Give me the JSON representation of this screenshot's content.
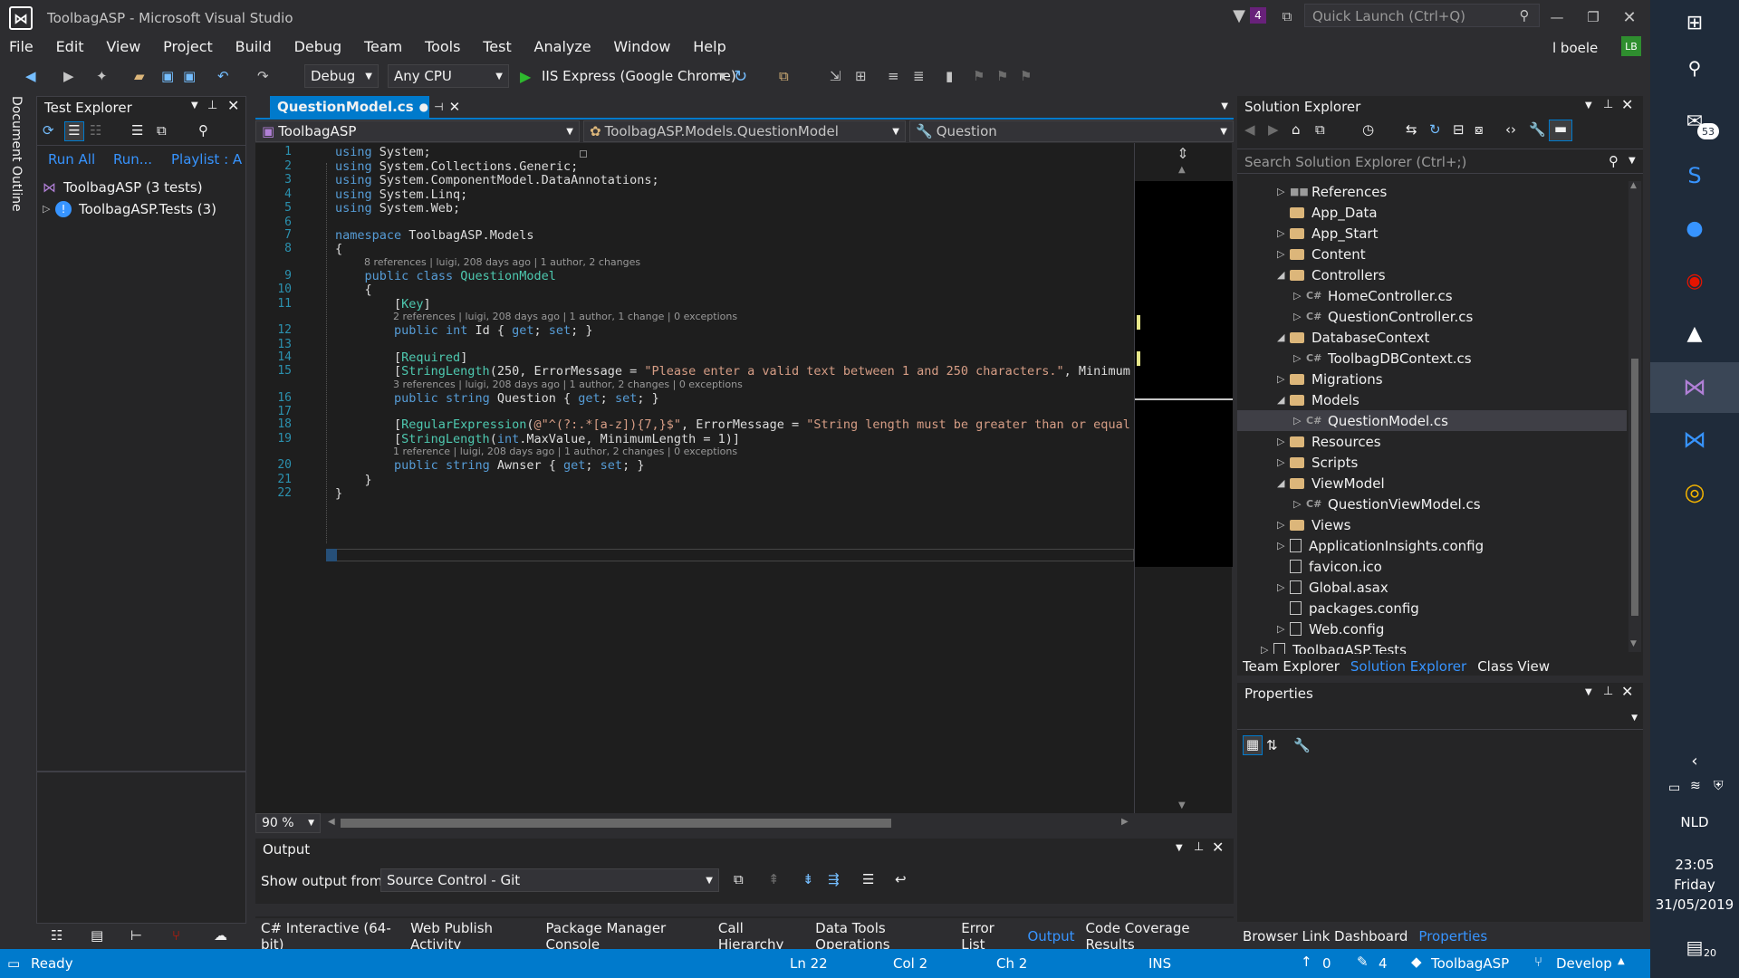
{
  "window": {
    "title": "ToolbagASP - Microsoft Visual Studio",
    "notif_count": "4",
    "quick_launch_placeholder": "Quick Launch (Ctrl+Q)",
    "user": "l boele",
    "user_initials": "LB"
  },
  "menu": [
    "File",
    "Edit",
    "View",
    "Project",
    "Build",
    "Debug",
    "Team",
    "Tools",
    "Test",
    "Analyze",
    "Window",
    "Help"
  ],
  "toolbar": {
    "config": "Debug",
    "platform": "Any CPU",
    "run_target": "IIS Express (Google Chrome)"
  },
  "test_explorer": {
    "title": "Test Explorer",
    "run_all": "Run All",
    "run": "Run...",
    "playlist": "Playlist : A",
    "items": [
      {
        "label": "ToolbagASP (3 tests)"
      },
      {
        "label": "ToolbagASP.Tests (3)"
      }
    ]
  },
  "side_tab": "Document Outline",
  "editor": {
    "tab": "QuestionModel.cs",
    "nav_project": "ToolbagASP",
    "nav_class": "ToolbagASP.Models.QuestionModel",
    "nav_member": "Question",
    "zoom": "90 %",
    "lines": [
      {
        "n": "1",
        "html": "<span class='kw'>using</span> System;"
      },
      {
        "n": "2",
        "html": "<span class='kw'>using</span> System.Collections.Generic;"
      },
      {
        "n": "3",
        "html": "<span class='kw'>using</span> System.ComponentModel.DataAnnotations;"
      },
      {
        "n": "4",
        "html": "<span class='kw'>using</span> System.Linq;"
      },
      {
        "n": "5",
        "html": "<span class='kw'>using</span> System.Web;"
      },
      {
        "n": "6",
        "html": ""
      },
      {
        "n": "7",
        "html": "<span class='kw'>namespace</span> ToolbagASP.Models"
      },
      {
        "n": "8",
        "html": "{"
      },
      {
        "lens": "8 references | luigi, 208 days ago | 1 author, 2 changes",
        "indent": 1
      },
      {
        "n": "9",
        "html": "    <span class='kw'>public</span> <span class='kw'>class</span> <span class='ty'>QuestionModel</span>"
      },
      {
        "n": "10",
        "html": "    {"
      },
      {
        "n": "11",
        "html": "        [<span class='at'>Key</span>]"
      },
      {
        "lens": "2 references | luigi, 208 days ago | 1 author, 1 change | 0 exceptions",
        "indent": 2
      },
      {
        "n": "12",
        "html": "        <span class='kw'>public</span> <span class='kw'>int</span> Id { <span class='kw'>get</span>; <span class='kw'>set</span>; }"
      },
      {
        "n": "13",
        "html": ""
      },
      {
        "n": "14",
        "html": "        [<span class='at'>Required</span>]"
      },
      {
        "n": "15",
        "html": "        [<span class='at'>StringLength</span>(250, ErrorMessage = <span class='st'>\"Please enter a valid text between 1 and 250 characters.\"</span>, Minimum"
      },
      {
        "lens": "3 references | luigi, 208 days ago | 1 author, 2 changes | 0 exceptions",
        "indent": 2
      },
      {
        "n": "16",
        "html": "        <span class='kw'>public</span> <span class='kw'>string</span> Question { <span class='kw'>get</span>; <span class='kw'>set</span>; }"
      },
      {
        "n": "17",
        "html": ""
      },
      {
        "n": "18",
        "html": "        [<span class='at'>RegularExpression</span>(<span class='st'>@\"^(?:.*[a-z]){7,}$\"</span>, ErrorMessage = <span class='st'>\"String length must be greater than or equal</span>"
      },
      {
        "n": "19",
        "html": "        [<span class='at'>StringLength</span>(<span class='kw'>int</span>.MaxValue, MinimumLength = 1)]"
      },
      {
        "lens": "1 reference | luigi, 208 days ago | 1 author, 2 changes | 0 exceptions",
        "indent": 2
      },
      {
        "n": "20",
        "html": "        <span class='kw'>public</span> <span class='kw'>string</span> Awnser { <span class='kw'>get</span>; <span class='kw'>set</span>; }"
      },
      {
        "n": "21",
        "html": "    }"
      },
      {
        "n": "22",
        "html": "}"
      }
    ]
  },
  "output": {
    "title": "Output",
    "show_from_label": "Show output from:",
    "source": "Source Control - Git"
  },
  "bottom_tabs": [
    "C# Interactive (64-bit)",
    "Web Publish Activity",
    "Package Manager Console",
    "Call Hierarchy",
    "Data Tools Operations",
    "Error List",
    "Output",
    "Code Coverage Results"
  ],
  "solution_explorer": {
    "title": "Solution Explorer",
    "search_placeholder": "Search Solution Explorer (Ctrl+;)",
    "items": [
      {
        "label": "References",
        "type": "ref",
        "level": 0,
        "arrow": "▷"
      },
      {
        "label": "App_Data",
        "type": "folder",
        "level": 0,
        "arrow": ""
      },
      {
        "label": "App_Start",
        "type": "folder",
        "level": 0,
        "arrow": "▷"
      },
      {
        "label": "Content",
        "type": "folder",
        "level": 0,
        "arrow": "▷"
      },
      {
        "label": "Controllers",
        "type": "folder",
        "level": 0,
        "arrow": "◢"
      },
      {
        "label": "HomeController.cs",
        "type": "cs",
        "level": 1,
        "arrow": "▷"
      },
      {
        "label": "QuestionController.cs",
        "type": "cs",
        "level": 1,
        "arrow": "▷"
      },
      {
        "label": "DatabaseContext",
        "type": "folder",
        "level": 0,
        "arrow": "◢"
      },
      {
        "label": "ToolbagDBContext.cs",
        "type": "cs",
        "level": 1,
        "arrow": "▷"
      },
      {
        "label": "Migrations",
        "type": "folder",
        "level": 0,
        "arrow": "▷"
      },
      {
        "label": "Models",
        "type": "folder",
        "level": 0,
        "arrow": "◢"
      },
      {
        "label": "QuestionModel.cs",
        "type": "cs",
        "level": 1,
        "arrow": "▷",
        "selected": true
      },
      {
        "label": "Resources",
        "type": "folder",
        "level": 0,
        "arrow": "▷"
      },
      {
        "label": "Scripts",
        "type": "folder",
        "level": 0,
        "arrow": "▷"
      },
      {
        "label": "ViewModel",
        "type": "folder",
        "level": 0,
        "arrow": "◢"
      },
      {
        "label": "QuestionViewModel.cs",
        "type": "cs",
        "level": 1,
        "arrow": "▷"
      },
      {
        "label": "Views",
        "type": "folder",
        "level": 0,
        "arrow": "▷"
      },
      {
        "label": "ApplicationInsights.config",
        "type": "file",
        "level": 0,
        "arrow": "▷"
      },
      {
        "label": "favicon.ico",
        "type": "file",
        "level": 0,
        "arrow": ""
      },
      {
        "label": "Global.asax",
        "type": "file",
        "level": 0,
        "arrow": "▷"
      },
      {
        "label": "packages.config",
        "type": "file",
        "level": 0,
        "arrow": ""
      },
      {
        "label": "Web.config",
        "type": "file",
        "level": 0,
        "arrow": "▷"
      },
      {
        "label": "ToolbagASP.Tests",
        "type": "file",
        "level": -1,
        "arrow": "▷"
      }
    ],
    "tabs": [
      "Team Explorer",
      "Solution Explorer",
      "Class View"
    ]
  },
  "properties": {
    "title": "Properties"
  },
  "right_bottom_tabs": [
    "Browser Link Dashboard",
    "Properties"
  ],
  "status": {
    "ready": "Ready",
    "ln": "Ln 22",
    "col": "Col 2",
    "ch": "Ch 2",
    "ins": "INS",
    "up": "0",
    "pencil": "4",
    "repo": "ToolbagASP",
    "branch": "Develop"
  },
  "taskbar": {
    "mail_count": "53",
    "lang": "NLD",
    "time": "23:05",
    "day": "Friday",
    "date": "31/05/2019",
    "notif": "20"
  },
  "colors": {
    "accent": "#007acc",
    "bg": "#2d2d30",
    "editor": "#1e1e1e"
  }
}
